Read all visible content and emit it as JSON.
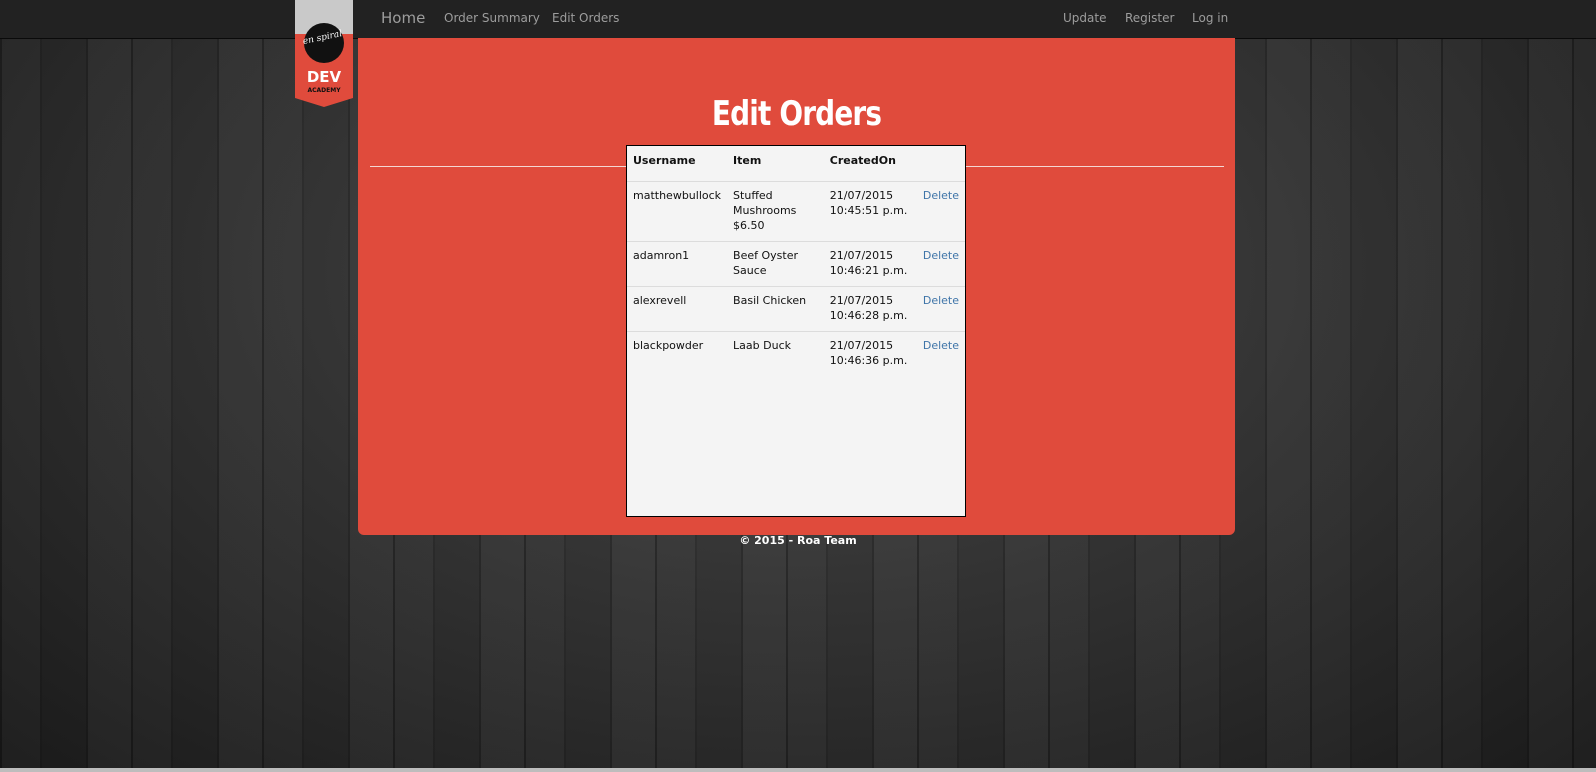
{
  "nav": {
    "brand": "Home",
    "left_links": [
      "Order Summary",
      "Edit Orders"
    ],
    "right_links": [
      "Update",
      "Register",
      "Log in"
    ]
  },
  "logo": {
    "top_text": "en spiral",
    "main_text": "DEV",
    "sub_text": "ACADEMY"
  },
  "page": {
    "title": "Edit Orders"
  },
  "orders_table": {
    "headers": [
      "Username",
      "Item",
      "CreatedOn"
    ],
    "rows": [
      {
        "username": "matthewbullock",
        "item": "Stuffed Mushrooms $6.50",
        "created_date": "21/07/2015",
        "created_time": "10:45:51 p.m.",
        "action": "Delete"
      },
      {
        "username": "adamron1",
        "item": "Beef Oyster Sauce",
        "created_date": "21/07/2015",
        "created_time": "10:46:21 p.m.",
        "action": "Delete"
      },
      {
        "username": "alexrevell",
        "item": "Basil Chicken",
        "created_date": "21/07/2015",
        "created_time": "10:46:28 p.m.",
        "action": "Delete"
      },
      {
        "username": "blackpowder",
        "item": "Laab Duck",
        "created_date": "21/07/2015",
        "created_time": "10:46:36 p.m.",
        "action": "Delete"
      }
    ]
  },
  "footer": {
    "text": "© 2015 - Roa Team"
  },
  "colors": {
    "card_bg": "#e04b3c",
    "navbar_bg": "#222222",
    "link_blue": "#3e74a8",
    "table_bg": "#f4f4f4"
  }
}
